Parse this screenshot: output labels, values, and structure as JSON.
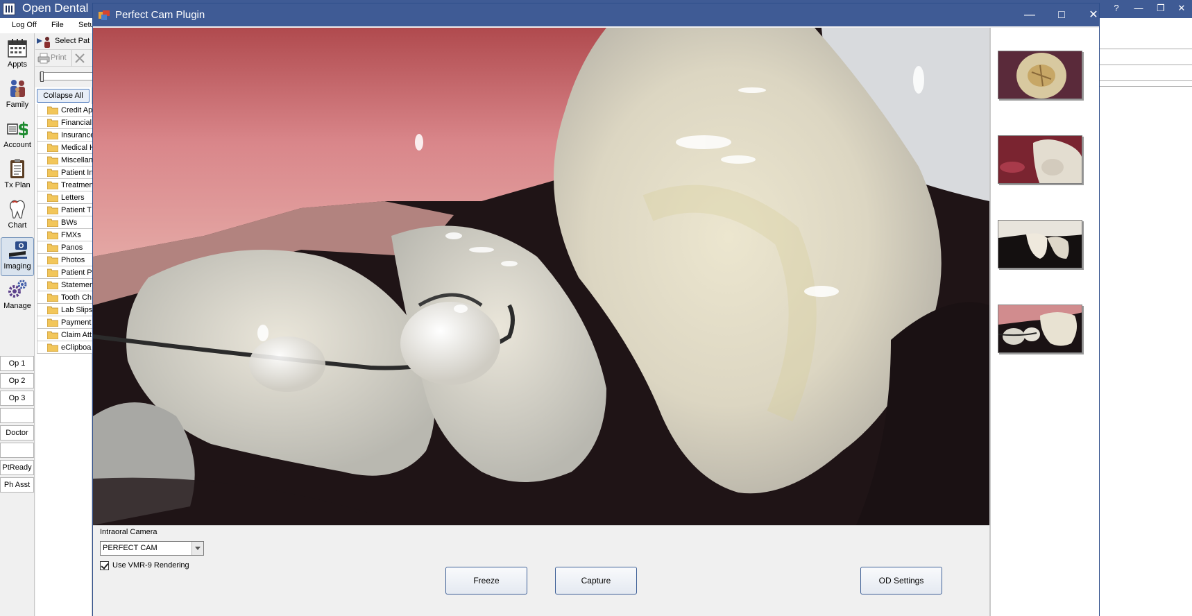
{
  "main_window": {
    "title": "Open Dental",
    "help_label": "?",
    "menu": [
      "Log Off",
      "File",
      "Setu"
    ]
  },
  "modules": [
    {
      "label": "Appts",
      "icon": "calendar-icon"
    },
    {
      "label": "Family",
      "icon": "family-icon"
    },
    {
      "label": "Account",
      "icon": "account-dollar-icon"
    },
    {
      "label": "Tx Plan",
      "icon": "clipboard-icon"
    },
    {
      "label": "Chart",
      "icon": "tooth-icon"
    },
    {
      "label": "Imaging",
      "icon": "camera-icon",
      "active": true
    },
    {
      "label": "Manage",
      "icon": "gears-icon"
    }
  ],
  "operatories": [
    "Op 1",
    "Op 2",
    "Op 3",
    "",
    "Doctor",
    "",
    "PtReady",
    "Ph Asst"
  ],
  "imaging": {
    "select_patient": "Select Pat",
    "print": "Print",
    "collapse_all": "Collapse All",
    "folders": [
      "Credit Ap",
      "Financial",
      "Insurance",
      "Medical H",
      "Miscellan",
      "Patient In",
      "Treatmen",
      "Letters",
      "Patient T",
      "BWs",
      "FMXs",
      "Panos",
      "Photos",
      "Patient P",
      "Statemen",
      "Tooth Ch",
      "Lab Slips",
      "Payment",
      "Claim Att",
      "eClipboa"
    ]
  },
  "dialog": {
    "title": "Perfect Cam Plugin",
    "camera_group_label": "Intraoral Camera",
    "camera_selected": "PERFECT CAM",
    "vmr_label": "Use VMR-9 Rendering",
    "vmr_checked": true,
    "freeze_label": "Freeze",
    "capture_label": "Capture",
    "settings_label": "OD Settings",
    "thumbnails": [
      "occlusal-molar-thumbnail",
      "molar-gingiva-thumbnail",
      "anterior-teeth-thumbnail",
      "incisor-gingiva-thumbnail"
    ]
  },
  "colors": {
    "titlebar": "#3f5b95",
    "button_border": "#3d5f96",
    "folder": "#f2c65a"
  }
}
